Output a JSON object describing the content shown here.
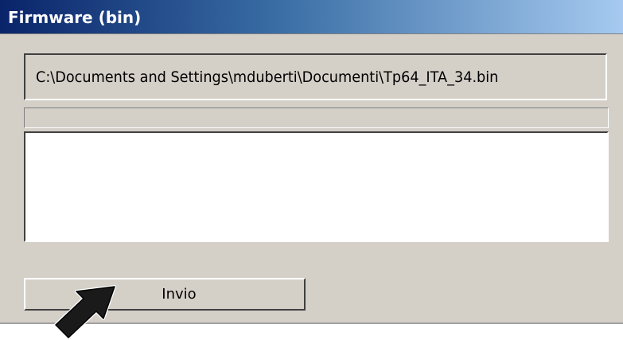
{
  "window": {
    "title": "Firmware (bin)"
  },
  "firmware_file": {
    "path": "C:\\Documents and Settings\\mduberti\\Documenti\\Tp64_ITA_34.bin"
  },
  "progress": {
    "value_percent": 0
  },
  "log": {
    "text": ""
  },
  "actions": {
    "send_label": "Invio"
  },
  "icons": {
    "pointer": "arrow-pointer-icon"
  },
  "colors": {
    "title_gradient_start": "#0a246a",
    "title_gradient_end": "#a6caf0",
    "window_background": "#d4d0c8"
  }
}
